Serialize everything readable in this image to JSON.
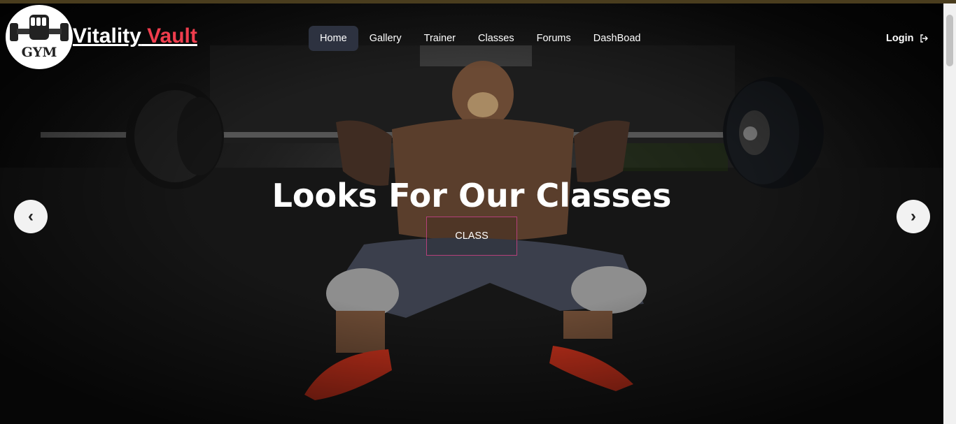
{
  "brand": {
    "name_primary": "Vitality",
    "name_accent": " Vault",
    "logo_text": "GYM"
  },
  "nav": {
    "items": [
      {
        "label": "Home",
        "active": true
      },
      {
        "label": "Gallery",
        "active": false
      },
      {
        "label": "Trainer",
        "active": false
      },
      {
        "label": "Classes",
        "active": false
      },
      {
        "label": "Forums",
        "active": false
      },
      {
        "label": "DashBoad",
        "active": false
      }
    ],
    "login_label": "Login",
    "login_icon": "login-icon"
  },
  "hero": {
    "headline": "Looks For Our Classes",
    "cta_label": "CLASS",
    "prev_arrow": "‹",
    "next_arrow": "›"
  },
  "colors": {
    "accent": "#ef3d4d",
    "active_nav_bg": "#2d3240",
    "cta_border": "#b4407a"
  }
}
